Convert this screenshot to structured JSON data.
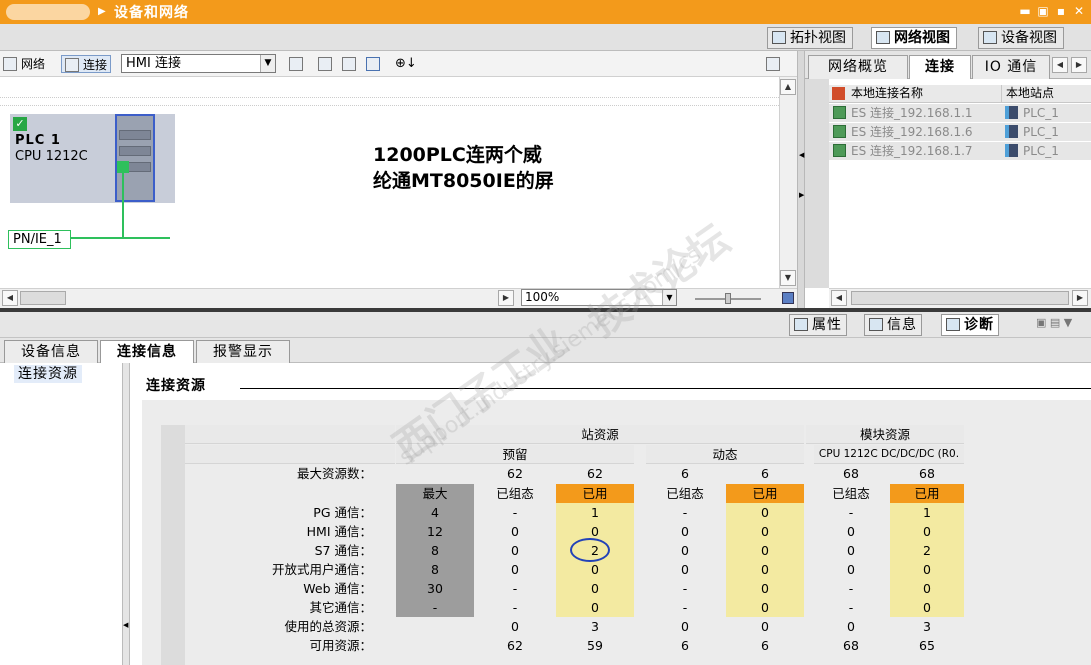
{
  "titlebar": {
    "breadcrumb": "设备和网络",
    "btn_min": "▬",
    "btn_restore": "▣",
    "btn_dock": "▪",
    "btn_close": "✕"
  },
  "views": [
    {
      "label": "拓扑视图",
      "active": false
    },
    {
      "label": "网络视图",
      "active": true
    },
    {
      "label": "设备视图",
      "active": false
    }
  ],
  "toolbar": {
    "network_label": "网络",
    "connect_label": "连接",
    "connection_type": "HMI 连接"
  },
  "device": {
    "name": "PLC_1",
    "name_display": "PLC 1",
    "cpu": "CPU 1212C",
    "subnet": "PN/IE_1"
  },
  "annotation": {
    "line1": "1200PLC连两个威",
    "line2": "纶通MT8050IE的屏"
  },
  "zoom": "100%",
  "right_panel": {
    "tabs": [
      {
        "label": "网络概览",
        "active": false
      },
      {
        "label": "连接",
        "active": true
      },
      {
        "label": "IO 通信",
        "active": false
      }
    ],
    "col_name": "本地连接名称",
    "col_station": "本地站点",
    "rows": [
      {
        "name": "ES 连接_192.168.1.1",
        "station": "PLC_1"
      },
      {
        "name": "ES 连接_192.168.1.6",
        "station": "PLC_1"
      },
      {
        "name": "ES 连接_192.168.1.7",
        "station": "PLC_1"
      }
    ]
  },
  "inspector": {
    "tabs": [
      {
        "label": "属性",
        "active": false
      },
      {
        "label": "信息",
        "active": false
      },
      {
        "label": "诊断",
        "active": true
      }
    ]
  },
  "subtabs": [
    {
      "label": "设备信息",
      "active": false
    },
    {
      "label": "连接信息",
      "active": true
    },
    {
      "label": "报警显示",
      "active": false
    }
  ],
  "nav_item": "连接资源",
  "section_title": "连接资源",
  "resources": {
    "station_header": "站资源",
    "module_header": "模块资源",
    "reserved_header": "预留",
    "dynamic_header": "动态",
    "module_name": "CPU 1212C DC/DC/DC (R0.",
    "max_label": "最大资源数：",
    "max_values": [
      "62",
      "62",
      "6",
      "6",
      "68",
      "68"
    ],
    "sub_headers": [
      "最大",
      "已组态",
      "已用",
      "已组态",
      "已用",
      "已组态",
      "已用"
    ],
    "rows": [
      {
        "label": "PG 通信：",
        "values": [
          "4",
          "-",
          "1",
          "-",
          "0",
          "-",
          "1"
        ]
      },
      {
        "label": "HMI 通信：",
        "values": [
          "12",
          "0",
          "0",
          "0",
          "0",
          "0",
          "0"
        ]
      },
      {
        "label": "S7 通信：",
        "values": [
          "8",
          "0",
          "2",
          "0",
          "0",
          "0",
          "2"
        ]
      },
      {
        "label": "开放式用户通信：",
        "values": [
          "8",
          "0",
          "0",
          "0",
          "0",
          "0",
          "0"
        ]
      },
      {
        "label": "Web 通信：",
        "values": [
          "30",
          "-",
          "0",
          "-",
          "0",
          "-",
          "0"
        ]
      },
      {
        "label": "其它通信：",
        "values": [
          "-",
          "-",
          "0",
          "-",
          "0",
          "-",
          "0"
        ]
      },
      {
        "label": "使用的总资源：",
        "values": [
          "",
          "0",
          "3",
          "0",
          "0",
          "0",
          "3"
        ]
      },
      {
        "label": "可用资源：",
        "values": [
          "",
          "62",
          "59",
          "6",
          "6",
          "68",
          "65"
        ]
      }
    ]
  },
  "watermark": {
    "line1": "西门子工业",
    "line2": "技术论坛",
    "line3": "support.industry.siemens.com/cs"
  },
  "colors": {
    "accent": "#f39a1b",
    "used_cell": "#f3eaa1",
    "max_cell": "#9d9d9d",
    "link_green": "#2ec05c"
  }
}
